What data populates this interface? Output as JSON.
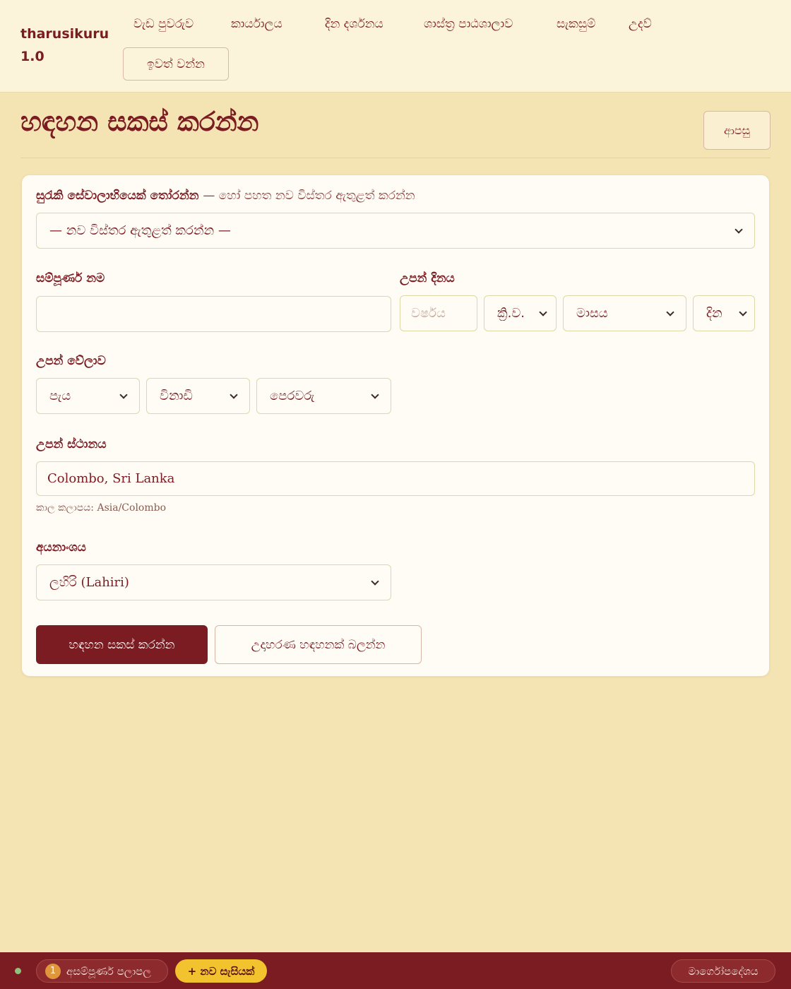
{
  "app": {
    "brand": "tharusikuru 1.0"
  },
  "nav": {
    "items": [
      {
        "label": "වැඩ පුවරුව"
      },
      {
        "label": "කාර්යාලය"
      },
      {
        "label": "දින දර්ශනය"
      },
      {
        "label": "ශාස්ත්‍ර පාඨශාලාව"
      },
      {
        "label": "සැකසුම්"
      },
      {
        "label": "උදව්"
      }
    ],
    "logout_label": "ඉවත් වන්න"
  },
  "page": {
    "title": "හඳහන සකස් කරන්න",
    "back_label": "ආපසු"
  },
  "form": {
    "saved_client": {
      "label": "සුරැකි සේවාලාභියෙක් තෝරන්න",
      "label_suffix": "— හෝ පහත නව විස්තර ඇතුළත් කරන්න",
      "selected": "— නව විස්තර ඇතුළත් කරන්න —"
    },
    "full_name": {
      "label": "සම්පූර්ණ නම",
      "value": ""
    },
    "birth_date": {
      "label": "උපන් දිනය",
      "year_placeholder": "වර්ෂය",
      "era": "ක්‍රි.ව.",
      "month": "මාසය",
      "day": "දින"
    },
    "birth_time": {
      "label": "උපන් වේලාව",
      "hour": "පැය",
      "minute": "විනාඩි",
      "ampm": "පෙරවරු"
    },
    "birth_place": {
      "label": "උපන් ස්ථානය",
      "value": "Colombo, Sri Lanka",
      "timezone_note": "කාල කලාපය: Asia/Colombo"
    },
    "ayanamsa": {
      "label": "අයනාංශය",
      "selected": "ලහිරි (Lahiri)"
    },
    "submit_label": "හඳහන සකස් කරන්න",
    "example_label": "උදාහරණ හඳහනක් බලන්න"
  },
  "footer": {
    "incomplete_count": "1",
    "incomplete_label": "අසම්පූර්ණ පලාපල",
    "new_session_label": "+ නව සැසියක්",
    "guide_label": "මාර්ගෝපදේශය"
  },
  "colors": {
    "primary": "#7a1c22",
    "background": "#f5e4b3",
    "header_bg": "#fcf3db",
    "accent_yellow": "#f3c32f",
    "status_green": "#8fc27a"
  }
}
